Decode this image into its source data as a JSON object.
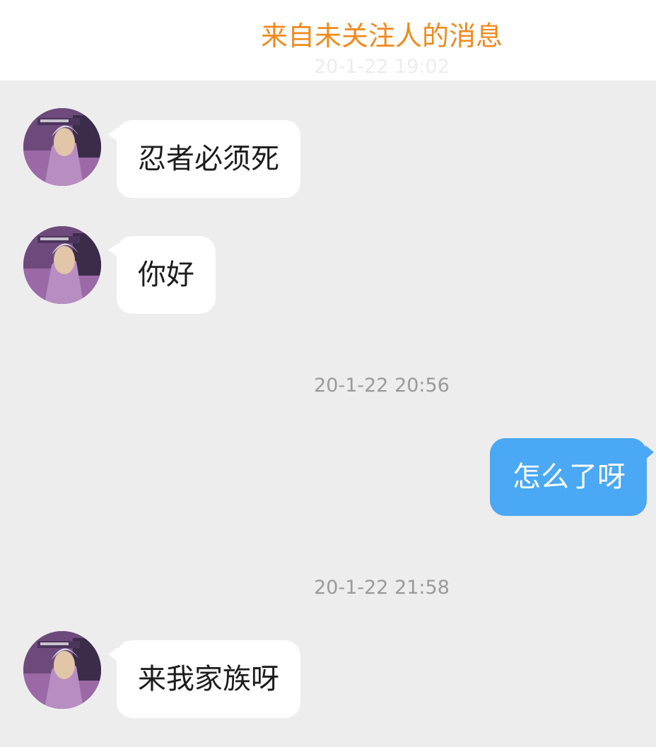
{
  "header": {
    "title": "来自未关注人的消息",
    "faded_time": "20-1-22 19:02"
  },
  "colors": {
    "title": "#f08a1c",
    "background": "#ededed",
    "incoming_bubble": "#ffffff",
    "outgoing_bubble": "#4aa8f5",
    "timestamp": "#9a9a9a"
  },
  "messages": [
    {
      "direction": "incoming",
      "avatar": "user-avatar",
      "text": "忍者必须死"
    },
    {
      "direction": "incoming",
      "avatar": "user-avatar",
      "text": "你好"
    },
    {
      "type": "timestamp",
      "text": "20-1-22 20:56"
    },
    {
      "direction": "outgoing",
      "text": "怎么了呀"
    },
    {
      "type": "timestamp",
      "text": "20-1-22 21:58"
    },
    {
      "direction": "incoming",
      "avatar": "user-avatar",
      "text": "来我家族呀"
    }
  ]
}
